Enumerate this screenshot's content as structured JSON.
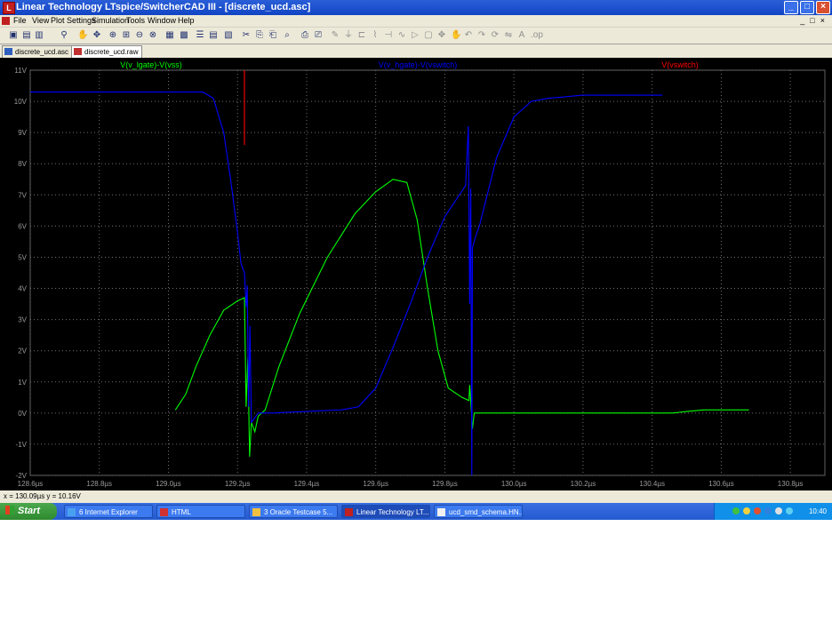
{
  "window": {
    "title": "Linear Technology LTspice/SwitcherCAD III - [discrete_ucd.asc]",
    "app_icon": "ltspice-icon"
  },
  "menu": [
    "File",
    "View",
    "Plot Settings",
    "Simulation",
    "Tools",
    "Window",
    "Help"
  ],
  "tabs": [
    {
      "label": "discrete_ucd.asc",
      "icon": "schematic-icon",
      "active": false
    },
    {
      "label": "discrete_ucd.raw",
      "icon": "waveform-icon",
      "active": true
    }
  ],
  "status": {
    "text": "x = 130.09µs   y = 10.16V"
  },
  "taskbar": {
    "start_label": "Start",
    "items": [
      {
        "label": "6 Internet Explorer",
        "active": false
      },
      {
        "label": "HTML",
        "active": false
      },
      {
        "label": "3 Oracle Testcase 5...",
        "active": false
      },
      {
        "label": "Linear Technology LT...",
        "active": true
      },
      {
        "label": "ucd_smd_schema.HN...",
        "active": false
      }
    ],
    "clock": "10:40"
  },
  "chart_data": {
    "type": "line",
    "x_unit": "µs",
    "y_unit": "V",
    "xlim": [
      128.6,
      130.9
    ],
    "ylim": [
      -2,
      11
    ],
    "x_ticks": [
      128.6,
      128.8,
      129.0,
      129.2,
      129.4,
      129.6,
      129.8,
      130.0,
      130.2,
      130.4,
      130.6,
      130.8
    ],
    "x_tick_labels": [
      "128.6µs",
      "128.8µs",
      "129.0µs",
      "129.2µs",
      "129.4µs",
      "129.6µs",
      "129.8µs",
      "130.0µs",
      "130.2µs",
      "130.4µs",
      "130.6µs",
      "130.8µs"
    ],
    "y_ticks": [
      -2,
      -1,
      0,
      1,
      2,
      3,
      4,
      5,
      6,
      7,
      8,
      9,
      10,
      11
    ],
    "y_tick_labels": [
      "-2V",
      "-1V",
      "0V",
      "1V",
      "2V",
      "3V",
      "4V",
      "5V",
      "6V",
      "7V",
      "8V",
      "9V",
      "10V",
      "11V"
    ],
    "grid": true,
    "background": "#000000",
    "series": [
      {
        "name": "V(v_lgate)-V(vss)",
        "color": "#00ff00",
        "points": [
          [
            129.02,
            0.1
          ],
          [
            129.05,
            0.6
          ],
          [
            129.08,
            1.5
          ],
          [
            129.12,
            2.5
          ],
          [
            129.16,
            3.3
          ],
          [
            129.2,
            3.6
          ],
          [
            129.22,
            3.7
          ],
          [
            129.225,
            0.2
          ],
          [
            129.23,
            1.8
          ],
          [
            129.235,
            -1.4
          ],
          [
            129.24,
            -0.3
          ],
          [
            129.25,
            -0.6
          ],
          [
            129.26,
            -0.1
          ],
          [
            129.28,
            0.1
          ],
          [
            129.32,
            1.5
          ],
          [
            129.38,
            3.2
          ],
          [
            129.46,
            5.0
          ],
          [
            129.54,
            6.4
          ],
          [
            129.6,
            7.1
          ],
          [
            129.65,
            7.5
          ],
          [
            129.69,
            7.4
          ],
          [
            129.72,
            6.2
          ],
          [
            129.75,
            4.0
          ],
          [
            129.78,
            2.0
          ],
          [
            129.81,
            0.8
          ],
          [
            129.85,
            0.5
          ],
          [
            129.87,
            0.4
          ],
          [
            129.872,
            0.9
          ],
          [
            129.876,
            0.2
          ],
          [
            129.88,
            -0.5
          ],
          [
            129.885,
            0.0
          ],
          [
            129.9,
            0.0
          ],
          [
            130.1,
            0.0
          ],
          [
            130.3,
            0.0
          ],
          [
            130.46,
            0.0
          ],
          [
            130.5,
            0.05
          ],
          [
            130.55,
            0.1
          ],
          [
            130.62,
            0.1
          ],
          [
            130.68,
            0.1
          ]
        ]
      },
      {
        "name": "V(v_hgate)-V(vswitch)",
        "color": "#0000ff",
        "points": [
          [
            128.6,
            10.3
          ],
          [
            128.8,
            10.3
          ],
          [
            129.0,
            10.3
          ],
          [
            129.1,
            10.3
          ],
          [
            129.13,
            10.1
          ],
          [
            129.16,
            9.0
          ],
          [
            129.18,
            7.5
          ],
          [
            129.2,
            5.8
          ],
          [
            129.21,
            4.8
          ],
          [
            129.22,
            4.5
          ],
          [
            129.225,
            3.4
          ],
          [
            129.228,
            4.1
          ],
          [
            129.232,
            0.2
          ],
          [
            129.236,
            2.8
          ],
          [
            129.24,
            -0.3
          ],
          [
            129.26,
            0.0
          ],
          [
            129.3,
            0.0
          ],
          [
            129.4,
            0.05
          ],
          [
            129.5,
            0.1
          ],
          [
            129.55,
            0.2
          ],
          [
            129.6,
            0.8
          ],
          [
            129.65,
            2.1
          ],
          [
            129.7,
            3.5
          ],
          [
            129.75,
            5.0
          ],
          [
            129.8,
            6.3
          ],
          [
            129.86,
            7.3
          ],
          [
            129.868,
            9.2
          ],
          [
            129.872,
            3.5
          ],
          [
            129.875,
            7.2
          ],
          [
            129.878,
            -2.0
          ],
          [
            129.88,
            5.3
          ],
          [
            129.89,
            5.7
          ],
          [
            129.9,
            6.0
          ],
          [
            129.95,
            8.2
          ],
          [
            130.0,
            9.5
          ],
          [
            130.05,
            10.0
          ],
          [
            130.1,
            10.1
          ],
          [
            130.2,
            10.2
          ],
          [
            130.3,
            10.2
          ],
          [
            130.43,
            10.2
          ]
        ]
      },
      {
        "name": "V(vswitch)",
        "color": "#ff0000",
        "points": [
          [
            129.22,
            11.0
          ],
          [
            129.22,
            8.6
          ]
        ]
      }
    ]
  }
}
